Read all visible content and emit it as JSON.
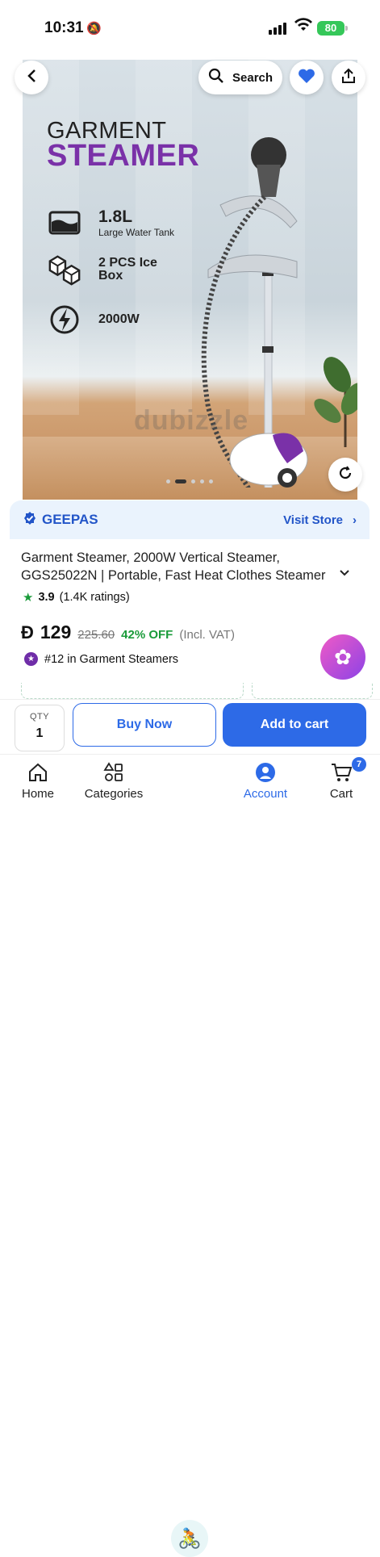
{
  "status": {
    "time": "10:31",
    "battery": "80"
  },
  "hero": {
    "heading_line1": "GARMENT",
    "heading_line2": "STEAMER",
    "features": [
      {
        "big": "1.8L",
        "small": "Large Water Tank"
      },
      {
        "line1": "2 PCS Ice",
        "line2": "Box"
      },
      {
        "big": "2000W"
      }
    ],
    "watermark": "dubizzle",
    "pager": {
      "current": 2,
      "total": 5
    }
  },
  "toolbar": {
    "search_label": "Search"
  },
  "store": {
    "brand": "GEEPAS",
    "visit": "Visit Store",
    "chevron": "›"
  },
  "product": {
    "title_line1": "Garment Steamer, 2000W Vertical Steamer,",
    "title_line2": "GGS25022N | Portable, Fast Heat Clothes Steamer",
    "rating": "3.9",
    "ratings_count": "(1.4K ratings)",
    "currency": "Đ",
    "price": "129",
    "was_price": "225.60",
    "discount": "42% OFF",
    "vat": "(Incl. VAT)",
    "rank": "#12 in Garment Steamers"
  },
  "buy": {
    "qty_label": "QTY",
    "qty_value": "1",
    "buy_now": "Buy Now",
    "add_to_cart": "Add to cart"
  },
  "tabs": {
    "home": "Home",
    "categories": "Categories",
    "account": "Account",
    "cart": "Cart",
    "cart_count": "7"
  }
}
